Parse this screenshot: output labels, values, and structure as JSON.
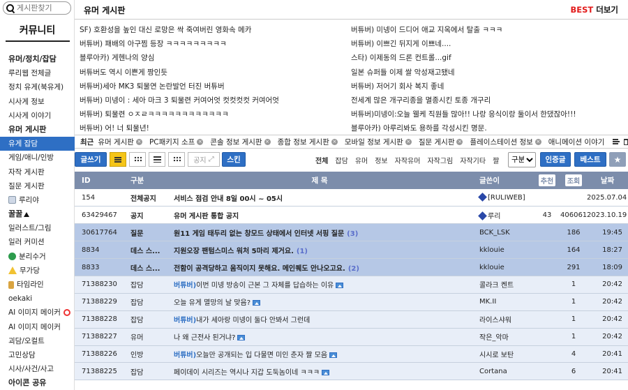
{
  "sidebar": {
    "search_placeholder": "게시판찾기",
    "title": "커뮤니티",
    "items": [
      {
        "label": "유머/정치/잡담",
        "type": "header"
      },
      {
        "label": "루리웹 전체글"
      },
      {
        "label": "정치 유게(북유게)"
      },
      {
        "label": "시사게 정보"
      },
      {
        "label": "시사게 이야기"
      },
      {
        "label": "유머 게시판",
        "type": "header"
      },
      {
        "label": "유게 잡담",
        "active": true
      },
      {
        "label": "게임/애니/인방"
      },
      {
        "label": "자작 게시판"
      },
      {
        "label": "질문 게시판"
      },
      {
        "label": "루리야",
        "icon": "document-icon"
      },
      {
        "label": "꿀꿀",
        "type": "header",
        "icon": "arrow-up-icon"
      },
      {
        "label": "일러스트/그림"
      },
      {
        "label": "일러 커미션"
      },
      {
        "label": "분리수거",
        "icon": "recycle-icon"
      },
      {
        "label": "무가당",
        "icon": "warning-icon"
      },
      {
        "label": "타임라인",
        "icon": "hourglass-icon"
      },
      {
        "label": "oekaki"
      },
      {
        "label": "AI 이미지 메이커",
        "icon": "no-entry-icon"
      },
      {
        "label": "AI 이미지 메이커"
      },
      {
        "label": "괴담/오컬트"
      },
      {
        "label": "고민상담"
      },
      {
        "label": "시사/사건/사고"
      },
      {
        "label": "아이콘 공유",
        "type": "header"
      },
      {
        "label": "유희왕"
      }
    ]
  },
  "header": {
    "title": "유머 게시판",
    "best_label": "BEST",
    "more_label": "더보기"
  },
  "best_posts": {
    "left": [
      "SF) 호환성을 높인 대신 로망은 싹 죽여버린 영화속 메카",
      "버튜버) 패배의 아구찜 등장 ㅋㅋㅋㅋㅋㅋㅋㅋㅋ",
      "블루아카) 게헨나의 양심",
      "버튜버도 역시 이쁜게 짱인듯",
      "버튜버)세아 MK3 퇴물연 논란발언 터진 버튜버",
      "버튜버) 미넹이 : 세아 마크 3 퇴물련 커여어엇 컷컷컷컷 커여어엇",
      "버튜버) 퇴물련 ㅇㅈㄹㅋㅋㅋㅋㅋㅋㅋㅋㅋㅋㅋㅋ",
      "버튜버) 어! 너 퇴물년!"
    ],
    "right": [
      "버튜버) 미넹이 드디어 애교 지옥에서 탈출 ㅋㅋㅋ",
      "버튜버) 이쁘긴 뒤지게 이쁘네....",
      "스타) 이제동의 드론 컨트롤...gif",
      "일본 슈퍼들 이제 쌀 악성재고됐네",
      "버튜버) 저어기 회사 복지 좋네",
      "전세계 많은 개구리종을 멸종시킨 토종 개구리",
      "버튜버)미넹이:오늘 웰케 직원들 많아!! 나랑 응식이랑 둘이서 한댔잖아!!!",
      "블루아카) 아루리봐도 용하를 각성시킨 명문."
    ]
  },
  "recent": {
    "label": "최근",
    "items": [
      "유머 게시판",
      "PC패키지 소프",
      "콘솔 정보 게시판",
      "종합 정보 게시판",
      "모바일 정보 게시판",
      "질문 게시판",
      "플레이스테이션 정보",
      "애니메이션 이야기"
    ]
  },
  "toolbar": {
    "write_label": "글쓰기",
    "share_label": "공지",
    "skin_label": "스킨",
    "filters": [
      "전체",
      "잡담",
      "유머",
      "정보",
      "자작유머",
      "자작그림",
      "자작기타",
      "짤"
    ],
    "sort_value": "구분",
    "cert_label": "인증글",
    "best_label": "베스트",
    "star_icon": "star-icon"
  },
  "table": {
    "headers": {
      "id": "ID",
      "cat": "구분",
      "subject": "제 목",
      "author": "글쓴이",
      "rec": "추천",
      "views": "조회",
      "date": "날짜"
    },
    "rows": [
      {
        "id": "154",
        "cat": "전체공지",
        "subject": "서비스 점검 안내 8일 00시 ~ 05시",
        "author": "[RULIWEB]",
        "rec": "",
        "views": "",
        "date": "2025.07.04",
        "kind": "notice",
        "author_icon": true
      },
      {
        "id": "63429467",
        "cat": "공지",
        "subject": "유머 게시판 통합 공지",
        "author": "루리",
        "rec": "43",
        "views": "406061",
        "date": "2023.10.19",
        "kind": "notice",
        "author_icon": true
      },
      {
        "id": "30617764",
        "cat": "질문",
        "subject": "원11 게임 태두리 없는 창모드 상태에서 인터넷 서핑 질문",
        "comments": "(3)",
        "author": "BCK_LSK",
        "rec": "",
        "views": "186",
        "date": "19:45",
        "kind": "hl"
      },
      {
        "id": "8834",
        "cat": "데스 스...",
        "subject": "지원오장 팬텀스미스 워처 5마리 제거요.",
        "comments": "(1)",
        "author": "kklouie",
        "rec": "",
        "views": "164",
        "date": "18:27",
        "kind": "hl"
      },
      {
        "id": "8833",
        "cat": "데스 스...",
        "subject": "전함이 공격당하고 움직이지 못해요. 메인퀘도 안나오고요.",
        "comments": "(2)",
        "author": "kklouie",
        "rec": "",
        "views": "291",
        "date": "18:09",
        "kind": "hl"
      },
      {
        "id": "71388230",
        "cat": "잡담",
        "tag": "버튜버)",
        "subject": "이번 미넹 방송이 근본 그 자체를 답습하는 이유",
        "img": true,
        "author": "콜라크 켄트",
        "rec": "",
        "views": "1",
        "date": "20:42",
        "kind": "norm"
      },
      {
        "id": "71388229",
        "cat": "잡담",
        "subject": "오늘 유게 멸망의 날 맞음?",
        "img": true,
        "author": "MK.II",
        "rec": "",
        "views": "1",
        "date": "20:42",
        "kind": "norm"
      },
      {
        "id": "71388228",
        "cat": "잡담",
        "tag": "버튜버)",
        "subject": "내가 세아랑 미넹이 둘다 안봐서 그런데",
        "author": "라이스샤워",
        "rec": "",
        "views": "1",
        "date": "20:42",
        "kind": "norm"
      },
      {
        "id": "71388227",
        "cat": "유머",
        "subject": "나 왜 근전사 된거냐?",
        "img": true,
        "author": "작은_악마",
        "rec": "",
        "views": "1",
        "date": "20:42",
        "kind": "norm"
      },
      {
        "id": "71388226",
        "cat": "인방",
        "tag": "버튜버)",
        "subject": "오늘만 공개되는 입 다물면 미인 춘자 짤 모음",
        "img": true,
        "author": "시시로 보탄",
        "rec": "",
        "views": "4",
        "date": "20:41",
        "kind": "norm"
      },
      {
        "id": "71388225",
        "cat": "잡담",
        "subject": "페이데이 시리즈는 역시나 지갑 도둑놈이네 ㅋㅋㅋ",
        "img": true,
        "author": "Cortana",
        "rec": "",
        "views": "6",
        "date": "20:41",
        "kind": "norm"
      }
    ]
  }
}
